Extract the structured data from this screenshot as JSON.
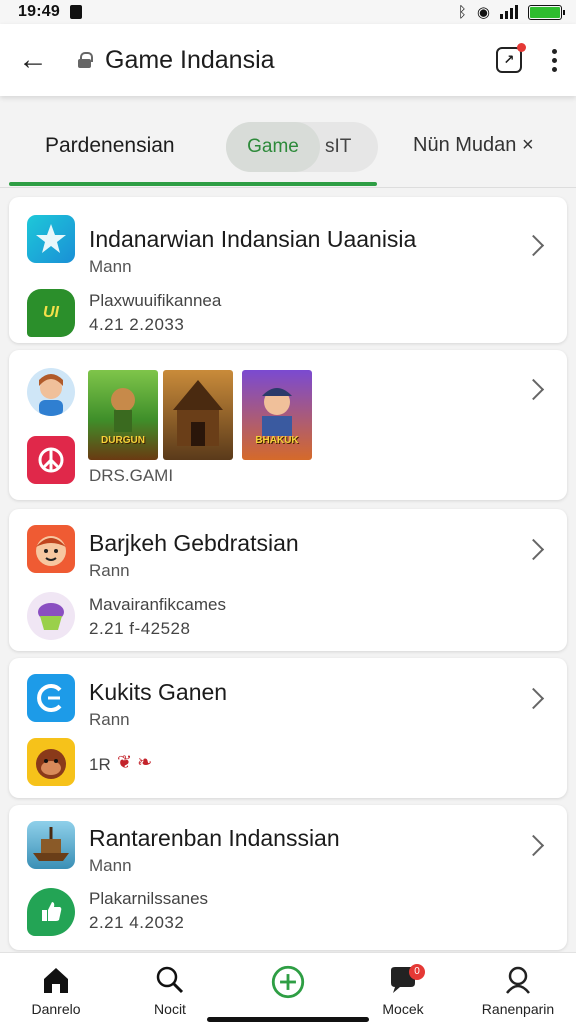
{
  "status_bar": {
    "time": "19:49",
    "battery_color": "#2ebd2e"
  },
  "app_bar": {
    "title": "Game Indansia"
  },
  "tabs": {
    "tab1": "Pardenensian",
    "tab2_selected": "Game",
    "tab2_rest": "sIT",
    "tab3": "Nün Mudan ×",
    "accent": "#2e9e44"
  },
  "cards": [
    {
      "title": "Indanarwian Indansian Uaanisia",
      "subtitle": "Mann",
      "info": "Plaxwuuifikannea",
      "number": "4.21 2.2033",
      "icon": "star-icon",
      "sub_icon": "chat-bubble-icon"
    },
    {
      "caption": "DRS.GAMI",
      "thumbs": [
        "DURGUN",
        "",
        "BHAKUK"
      ],
      "icon": "avatar-icon",
      "sub_icon": "peace-icon"
    },
    {
      "title": "Barjkeh Gebdratsian",
      "subtitle": "Rann",
      "info": "Mavairanfikcames",
      "number": "2.21 f-42528",
      "icon": "face-icon",
      "sub_icon": "cupcake-icon"
    },
    {
      "title": "Kukits Ganen",
      "subtitle": "Rann",
      "info": "1R",
      "icon": "c-logo-icon",
      "sub_icon": "monkey-icon"
    },
    {
      "title": "Rantarenban Indanssian",
      "subtitle": "Mann",
      "info": "Plakarnilssanes",
      "number": "2.21 4.2032",
      "icon": "ship-icon",
      "sub_icon": "like-bubble-icon"
    }
  ],
  "bottom_nav": [
    {
      "label": "Danrelo",
      "icon": "home-icon"
    },
    {
      "label": "Nocit",
      "icon": "search-icon"
    },
    {
      "label": "",
      "icon": "add-circle-icon"
    },
    {
      "label": "Mocek",
      "icon": "chat-icon",
      "badge": "0"
    },
    {
      "label": "Ranenparin",
      "icon": "profile-icon"
    }
  ]
}
